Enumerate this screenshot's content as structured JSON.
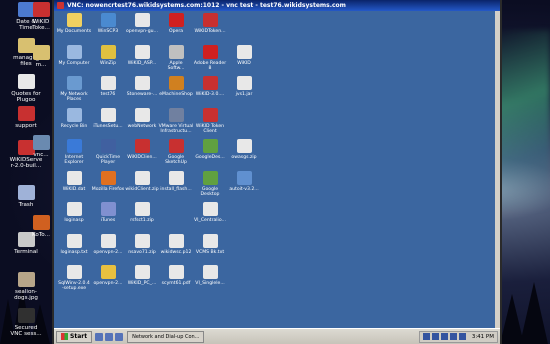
{
  "host_desktop": {
    "icons": [
      {
        "label": "Date &\nTime",
        "color": "#4c7ad0"
      },
      {
        "label": "manage_\nfiles",
        "color": "#d8c070"
      },
      {
        "label": "Quotes for\nPlugoo",
        "color": "#e8e8e8"
      },
      {
        "label": "support",
        "color": "#c83030"
      },
      {
        "label": "WiKIDServe\nr-2.0-buil...",
        "color": "#c83030"
      },
      {
        "label": "Trash",
        "color": "#9fb2d8"
      },
      {
        "label": "Terminal",
        "color": "#c9c9c9"
      },
      {
        "label": "sealion-\ndogs.jpg",
        "color": "#b7a589"
      },
      {
        "label": "Secured\nVNC sess...",
        "color": "#303030"
      }
    ],
    "partial_icons": [
      {
        "label": "WiKID\nToke...",
        "color": "#c83030"
      },
      {
        "label": "m...",
        "color": "#d8c070"
      },
      {
        "label": "vnc...",
        "color": "#6a8ab0"
      },
      {
        "label": "KoTo...",
        "color": "#d06020"
      }
    ]
  },
  "vnc_window": {
    "title": "VNC: nowencrtest76.wikidsystems.com:1012 - vnc test - test76.wikidsystems.com",
    "icons": [
      {
        "label": "My Documents",
        "color": "#f0d060"
      },
      {
        "label": "WinSCP3",
        "color": "#4a8ad0"
      },
      {
        "label": "openvpn-gu...",
        "color": "#e8e8e8"
      },
      {
        "label": "Opera",
        "color": "#d02020"
      },
      {
        "label": "WiKIDToken...",
        "color": "#c83030"
      },
      {
        "label": "My Computer",
        "color": "#9ab8e0"
      },
      {
        "label": "WinZip",
        "color": "#e0c040"
      },
      {
        "label": "WiKID_ASP...",
        "color": "#e8e8e8"
      },
      {
        "label": "Apple\nSoftw...",
        "color": "#c0c0c0"
      },
      {
        "label": "Adobe Reader\n8",
        "color": "#d02020"
      },
      {
        "label": "WiKID",
        "color": "#e8e8e8"
      },
      {
        "label": "My Network\nPlaces",
        "color": "#6a9ad0"
      },
      {
        "label": "test76",
        "color": "#e8e8e8"
      },
      {
        "label": "Stoneware-...",
        "color": "#e8e8e8"
      },
      {
        "label": "eMachineShop",
        "color": "#d08020"
      },
      {
        "label": "WiKID-3.0....",
        "color": "#c83030"
      },
      {
        "label": "jvs1.jar",
        "color": "#e8e8e8"
      },
      {
        "label": "Recycle Bin",
        "color": "#9ab8e0"
      },
      {
        "label": "iTunesSetu...",
        "color": "#e8e8e8"
      },
      {
        "label": "webNetwork",
        "color": "#e8e8e8"
      },
      {
        "label": "VMware Virtual\nInfrastructu...",
        "color": "#7080a0"
      },
      {
        "label": "WiKID Token\nClient",
        "color": "#c83030"
      },
      {
        "label": "Internet\nExplorer",
        "color": "#3a7ad8"
      },
      {
        "label": "QuickTime\nPlayer",
        "color": "#4060a0"
      },
      {
        "label": "WiKIDClien...",
        "color": "#c83030"
      },
      {
        "label": "Google\nSketchUp",
        "color": "#c83030"
      },
      {
        "label": "GoogleDes...",
        "color": "#60a040"
      },
      {
        "label": "owasgs.zip",
        "color": "#e8e8e8"
      },
      {
        "label": "WiKID.dat",
        "color": "#e8e8e8"
      },
      {
        "label": "Mozilla Firefox",
        "color": "#e07020"
      },
      {
        "label": "wikidClient.zip",
        "color": "#e8e8e8"
      },
      {
        "label": "install_flash...",
        "color": "#e8e8e8"
      },
      {
        "label": "Google\nDesktop",
        "color": "#60a040"
      },
      {
        "label": "autoit-v3.2...",
        "color": "#6090d0"
      },
      {
        "label": "loginasp",
        "color": "#e8e8e8"
      },
      {
        "label": "iTunes",
        "color": "#8090d0"
      },
      {
        "label": "rsfsct1.zip",
        "color": "#e8e8e8"
      },
      {
        "label": "VI_Centralio...",
        "color": "#e8e8e8"
      },
      {
        "label": "loginasp.txt",
        "color": "#e8e8e8"
      },
      {
        "label": "openvpn-2...",
        "color": "#e8e8e8"
      },
      {
        "label": "nsavo71.zip",
        "color": "#e8e8e8"
      },
      {
        "label": "wikidwsc.p12",
        "color": "#e8e8e8"
      },
      {
        "label": "VCMS Bk.txt",
        "color": "#e8e8e8"
      },
      {
        "label": "SqlWinv-2.0.4\n-setup.exe",
        "color": "#e8e8e8"
      },
      {
        "label": "openvpn-2...",
        "color": "#e8c040"
      },
      {
        "label": "WiKID_PC_...",
        "color": "#e8e8e8"
      },
      {
        "label": "scymt61.pdf",
        "color": "#e8e8e8"
      },
      {
        "label": "VI_Singlele...",
        "color": "#e8e8e8"
      }
    ],
    "taskbar": {
      "start_label": "Start",
      "task_label": "Network and Dial-up Con...",
      "clock": "3:41 PM"
    }
  }
}
